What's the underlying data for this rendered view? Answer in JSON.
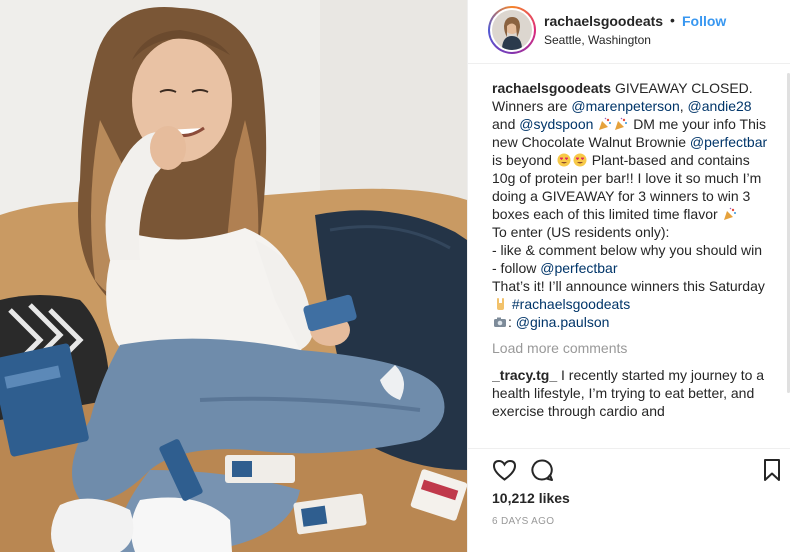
{
  "post": {
    "username": "rachaelsgoodeats",
    "separator": "•",
    "follow_label": "Follow",
    "location": "Seattle, Washington",
    "photo_alt": "Woman sitting on a couch eating a snack bar"
  },
  "caption": {
    "username": "rachaelsgoodeats",
    "t1": "GIVEAWAY CLOSED. Winners are",
    "m1": "@marenpeterson",
    "t2": ",",
    "m2": "@andie28",
    "t3": "and",
    "m3": "@sydspoon",
    "t4": "DM me your info This new Chocolate Walnut Brownie",
    "m4": "@perfectbar",
    "t5": "is beyond",
    "t6": "Plant-based and contains 10g of protein per bar!! I love it so much I’m doing a GIVEAWAY for 3 winners to win 3 boxes each of this limited time flavor",
    "t7": "To enter (US residents only):",
    "t8": "- like & comment below why you should win",
    "t9": "- follow",
    "m5": "@perfectbar",
    "t10": "That’s it! I’ll announce winners this Saturday",
    "h1": "#rachaelsgoodeats",
    "m6": "@gina.paulson"
  },
  "load_more": "Load more comments",
  "comment": {
    "username": "_tracy.tg_",
    "text": "I recently started my journey to a health lifestyle, I’m trying to eat better, and exercise through cardio and"
  },
  "likes": "10,212 likes",
  "date": "6 DAYS AGO",
  "icons": {
    "like": "heart-icon",
    "comment": "comment-icon",
    "save": "bookmark-icon",
    "party": "party-popper-emoji",
    "heart_eyes": "heart-eyes-emoji",
    "rock": "rock-hand-emoji",
    "camera": "camera-emoji"
  },
  "colors": {
    "link": "#003569",
    "follow": "#3897f0",
    "muted": "#999999",
    "text": "#262626"
  }
}
